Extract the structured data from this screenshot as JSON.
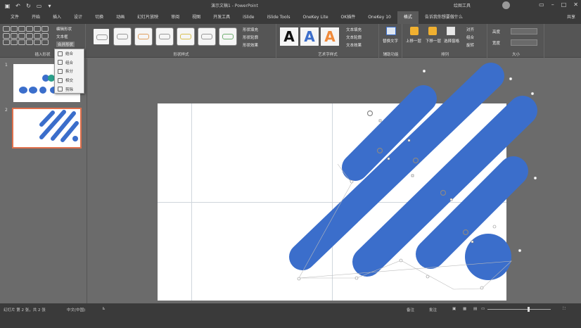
{
  "titlebar": {
    "title": "演示文稿1 - PowerPoint",
    "user": "绘图工具",
    "icons": [
      "save-icon",
      "undo-icon",
      "redo-icon",
      "present-icon",
      "customize-icon"
    ]
  },
  "tabs": [
    "文件",
    "开始",
    "插入",
    "设计",
    "切换",
    "动画",
    "幻灯片放映",
    "审阅",
    "视图",
    "开发工具",
    "iSlide",
    "iSlide Tools",
    "OneKey Lite",
    "OK插件",
    "OneKey 10",
    "格式",
    "告诉我你想要做什么"
  ],
  "tabs_help": "共享",
  "ribbon": {
    "insert_shapes_label": "插入形状",
    "edit_shape": "编辑形状",
    "text_box": "文本框",
    "merge_shapes": "合并形状",
    "shape_styles_label": "形状样式",
    "shape_fill": "形状填充",
    "shape_outline": "形状轮廓",
    "shape_effects": "形状效果",
    "wordart_label": "艺术字样式",
    "text_fill": "文本填充",
    "text_outline": "文本轮廓",
    "text_effects": "文本效果",
    "accessibility_label": "辅助功能",
    "alt_text": "替换文字",
    "arrange_label": "排列",
    "bring_forward": "上移一层",
    "send_backward": "下移一层",
    "selection_pane": "选择窗格",
    "align": "对齐",
    "group": "组合",
    "rotate": "旋转",
    "size_label": "大小",
    "height_label": "高度",
    "width_label": "宽度"
  },
  "merge_menu": [
    "结合",
    "组合",
    "拆分",
    "相交",
    "剪除"
  ],
  "slides": [
    {
      "number": "1"
    },
    {
      "number": "2"
    }
  ],
  "statusbar": {
    "slide_info": "幻灯片 第 2 张，共 2 张",
    "language": "中文(中国)",
    "notes": "备注",
    "comments": "批注"
  },
  "colors": {
    "shape_blue": "#3b6ecb",
    "selection_border": "#e0704c",
    "ribbon_bg": "#555555",
    "titlebar_bg": "#3a3a3a"
  }
}
